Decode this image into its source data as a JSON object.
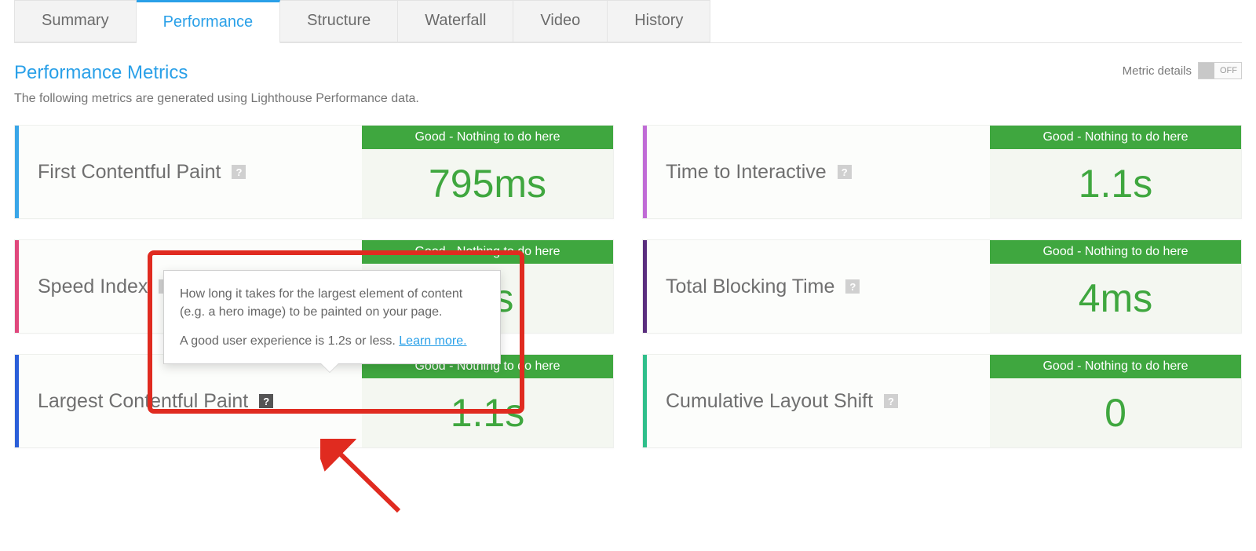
{
  "tabs": [
    {
      "label": "Summary",
      "active": false
    },
    {
      "label": "Performance",
      "active": true
    },
    {
      "label": "Structure",
      "active": false
    },
    {
      "label": "Waterfall",
      "active": false
    },
    {
      "label": "Video",
      "active": false
    },
    {
      "label": "History",
      "active": false
    }
  ],
  "section": {
    "title": "Performance Metrics",
    "description": "The following metrics are generated using Lighthouse Performance data.",
    "toggle_label": "Metric details",
    "toggle_state": "OFF"
  },
  "metrics": [
    {
      "name": "First Contentful Paint",
      "status": "Good - Nothing to do here",
      "value": "795ms",
      "bar_color": "#3aa6e8",
      "help_active": false
    },
    {
      "name": "Time to Interactive",
      "status": "Good - Nothing to do here",
      "value": "1.1s",
      "bar_color": "#c06bd6",
      "help_active": false
    },
    {
      "name": "Speed Index",
      "status": "Good - Nothing to do here",
      "value": "ms",
      "bar_color": "#e0487d",
      "help_active": false
    },
    {
      "name": "Total Blocking Time",
      "status": "Good - Nothing to do here",
      "value": "4ms",
      "bar_color": "#5a2e7e",
      "help_active": false
    },
    {
      "name": "Largest Contentful Paint",
      "status": "Good - Nothing to do here",
      "value": "1.1s",
      "bar_color": "#2b5fd9",
      "help_active": true
    },
    {
      "name": "Cumulative Layout Shift",
      "status": "Good - Nothing to do here",
      "value": "0",
      "bar_color": "#2fbf8b",
      "help_active": false
    }
  ],
  "tooltip": {
    "p1": "How long it takes for the largest element of content (e.g. a hero image) to be painted on your page.",
    "p2": "A good user experience is 1.2s or less.",
    "link": "Learn more."
  }
}
